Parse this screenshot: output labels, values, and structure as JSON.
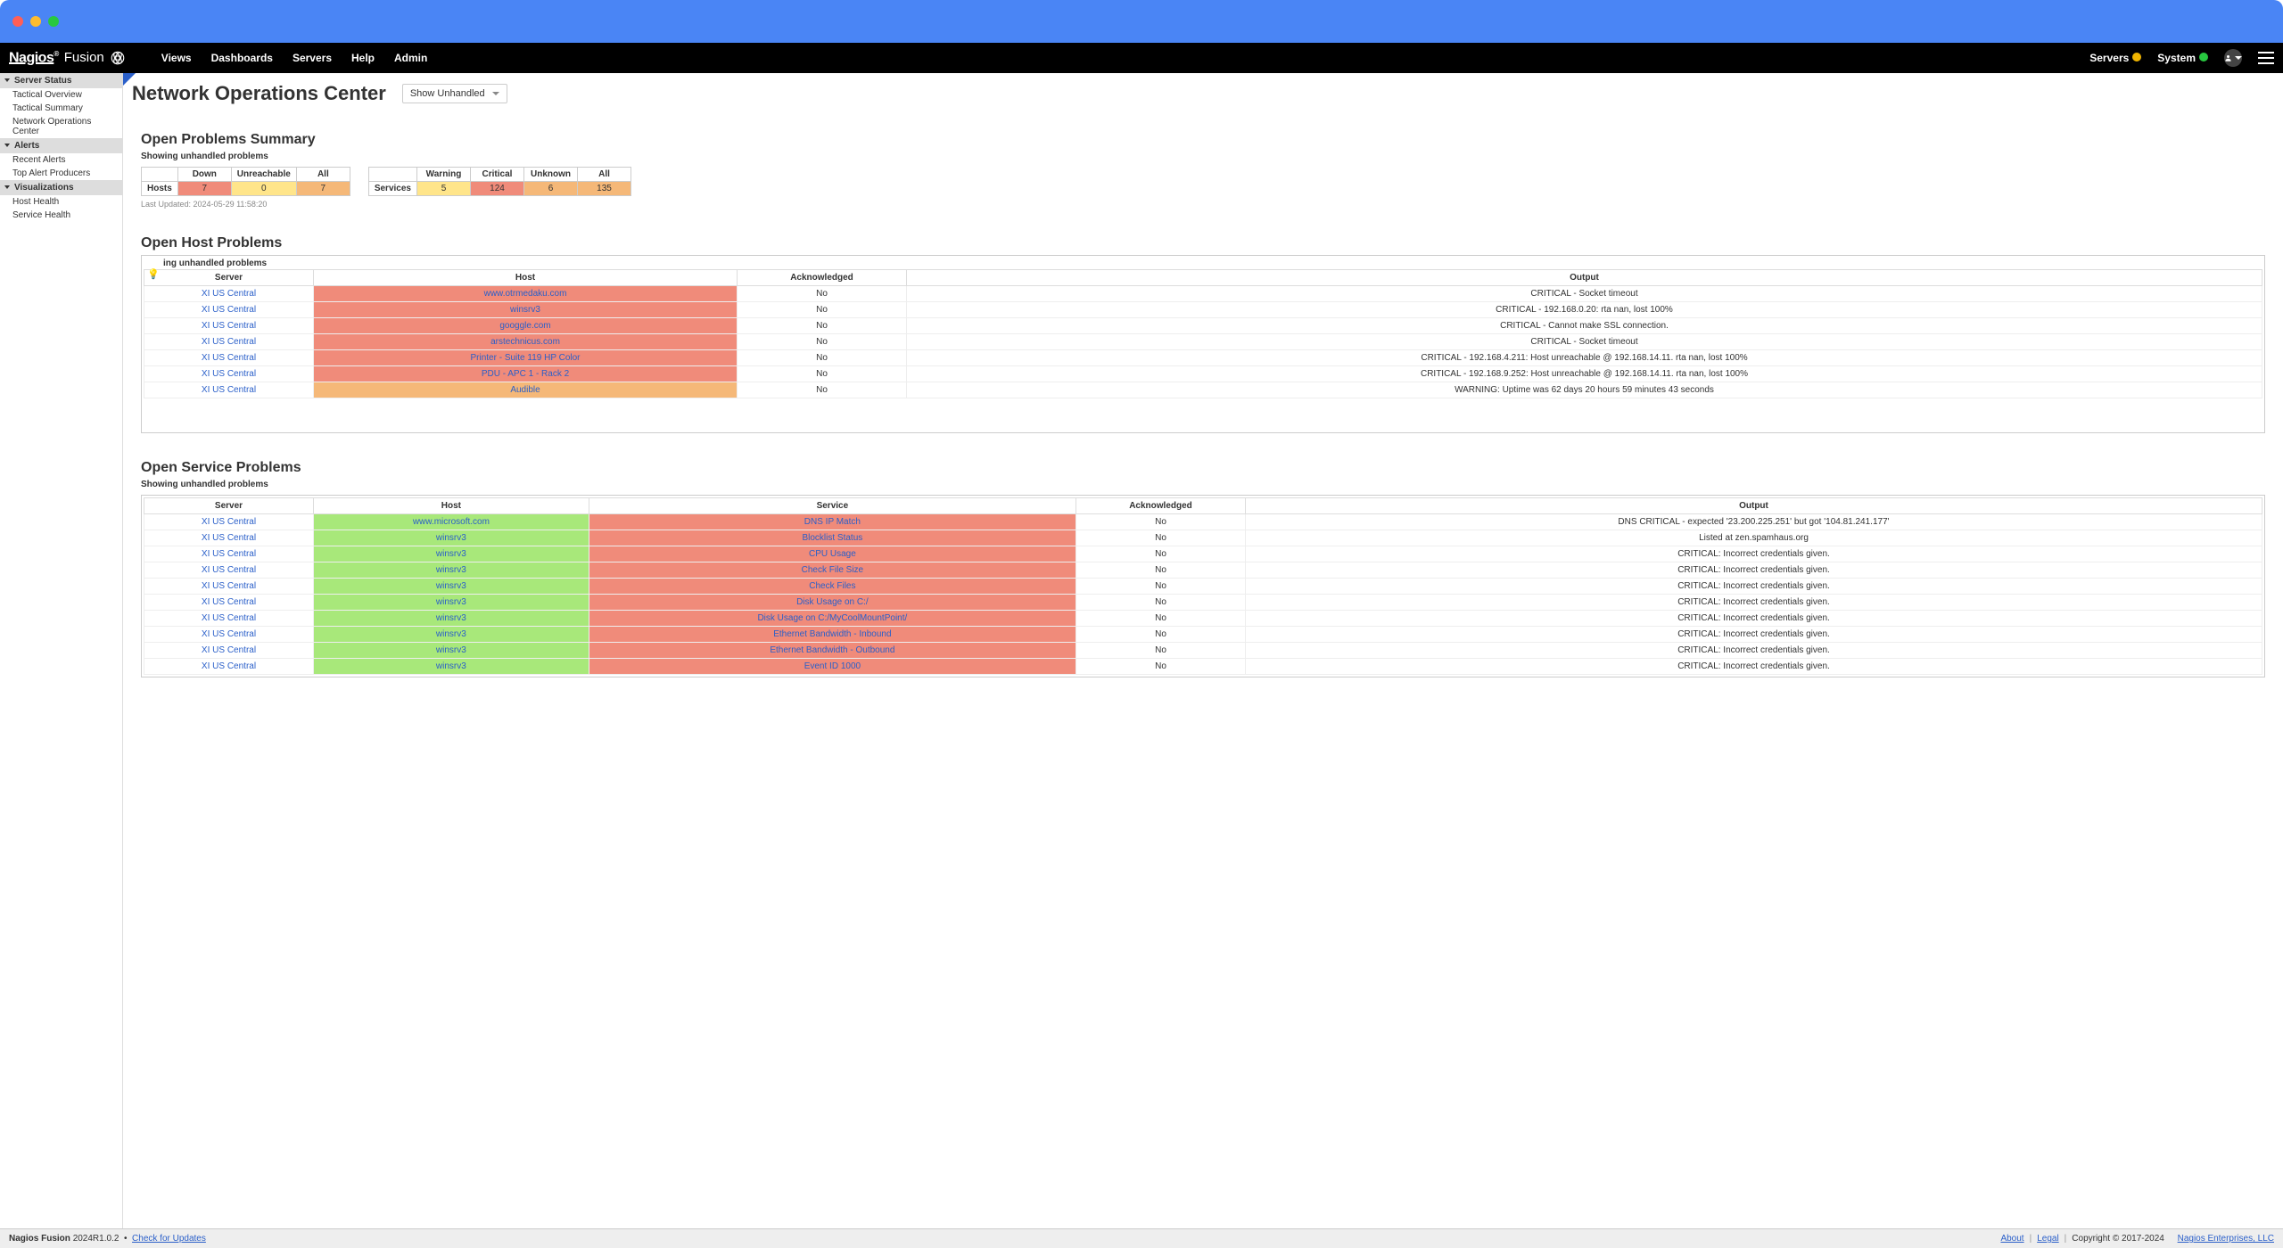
{
  "brand": {
    "main": "Nagios",
    "sub": "Fusion"
  },
  "nav": {
    "views": "Views",
    "dashboards": "Dashboards",
    "servers": "Servers",
    "help": "Help",
    "admin": "Admin",
    "right_servers": "Servers",
    "right_system": "System"
  },
  "sidebar": {
    "groups": [
      {
        "label": "Server Status",
        "items": [
          "Tactical Overview",
          "Tactical Summary",
          "Network Operations Center"
        ]
      },
      {
        "label": "Alerts",
        "items": [
          "Recent Alerts",
          "Top Alert Producers"
        ]
      },
      {
        "label": "Visualizations",
        "items": [
          "Host Health",
          "Service Health"
        ]
      }
    ]
  },
  "page": {
    "title": "Network Operations Center",
    "filter_selected": "Show Unhandled"
  },
  "summary": {
    "title": "Open Problems Summary",
    "subtitle": "Showing unhandled problems",
    "hosts": {
      "row_label": "Hosts",
      "headers": [
        "Down",
        "Unreachable",
        "All"
      ],
      "values": [
        "7",
        "0",
        "7"
      ],
      "classes": [
        "cell-red",
        "cell-yellow",
        "cell-orange"
      ]
    },
    "services": {
      "row_label": "Services",
      "headers": [
        "Warning",
        "Critical",
        "Unknown",
        "All"
      ],
      "values": [
        "5",
        "124",
        "6",
        "135"
      ],
      "classes": [
        "cell-yellow",
        "cell-red",
        "cell-orange",
        "cell-orange"
      ]
    },
    "last_updated": "Last Updated: 2024-05-29 11:58:20"
  },
  "host_problems": {
    "title": "Open Host Problems",
    "caption": "ing unhandled problems",
    "headers": [
      "Server",
      "Host",
      "Acknowledged",
      "Output"
    ],
    "rows": [
      {
        "server": "XI US Central",
        "host": "www.otrmedaku.com",
        "host_class": "host-critical",
        "ack": "No",
        "output": "CRITICAL - Socket timeout"
      },
      {
        "server": "XI US Central",
        "host": "winsrv3",
        "host_class": "host-critical",
        "ack": "No",
        "output": "CRITICAL - 192.168.0.20: rta nan, lost 100%"
      },
      {
        "server": "XI US Central",
        "host": "googgle.com",
        "host_class": "host-critical",
        "ack": "No",
        "output": "CRITICAL - Cannot make SSL connection."
      },
      {
        "server": "XI US Central",
        "host": "arstechnicus.com",
        "host_class": "host-critical",
        "ack": "No",
        "output": "CRITICAL - Socket timeout"
      },
      {
        "server": "XI US Central",
        "host": "Printer - Suite 119 HP Color",
        "host_class": "host-critical",
        "ack": "No",
        "output": "CRITICAL - 192.168.4.211: Host unreachable @ 192.168.14.11. rta nan, lost 100%"
      },
      {
        "server": "XI US Central",
        "host": "PDU - APC 1 - Rack 2",
        "host_class": "host-critical",
        "ack": "No",
        "output": "CRITICAL - 192.168.9.252: Host unreachable @ 192.168.14.11. rta nan, lost 100%"
      },
      {
        "server": "XI US Central",
        "host": "Audible",
        "host_class": "host-warning",
        "ack": "No",
        "output": "WARNING: Uptime was 62 days 20 hours 59 minutes 43 seconds"
      }
    ]
  },
  "service_problems": {
    "title": "Open Service Problems",
    "subtitle": "Showing unhandled problems",
    "headers": [
      "Server",
      "Host",
      "Service",
      "Acknowledged",
      "Output"
    ],
    "rows": [
      {
        "server": "XI US Central",
        "host": "www.microsoft.com",
        "service": "DNS IP Match",
        "ack": "No",
        "output": "DNS CRITICAL - expected '23.200.225.251' but got '104.81.241.177'"
      },
      {
        "server": "XI US Central",
        "host": "winsrv3",
        "service": "Blocklist Status",
        "ack": "No",
        "output": "Listed at zen.spamhaus.org"
      },
      {
        "server": "XI US Central",
        "host": "winsrv3",
        "service": "CPU Usage",
        "ack": "No",
        "output": "CRITICAL: Incorrect credentials given."
      },
      {
        "server": "XI US Central",
        "host": "winsrv3",
        "service": "Check File Size",
        "ack": "No",
        "output": "CRITICAL: Incorrect credentials given."
      },
      {
        "server": "XI US Central",
        "host": "winsrv3",
        "service": "Check Files",
        "ack": "No",
        "output": "CRITICAL: Incorrect credentials given."
      },
      {
        "server": "XI US Central",
        "host": "winsrv3",
        "service": "Disk Usage on C:/",
        "ack": "No",
        "output": "CRITICAL: Incorrect credentials given."
      },
      {
        "server": "XI US Central",
        "host": "winsrv3",
        "service": "Disk Usage on C:/MyCoolMountPoint/",
        "ack": "No",
        "output": "CRITICAL: Incorrect credentials given."
      },
      {
        "server": "XI US Central",
        "host": "winsrv3",
        "service": "Ethernet Bandwidth - Inbound",
        "ack": "No",
        "output": "CRITICAL: Incorrect credentials given."
      },
      {
        "server": "XI US Central",
        "host": "winsrv3",
        "service": "Ethernet Bandwidth - Outbound",
        "ack": "No",
        "output": "CRITICAL: Incorrect credentials given."
      },
      {
        "server": "XI US Central",
        "host": "winsrv3",
        "service": "Event ID 1000",
        "ack": "No",
        "output": "CRITICAL: Incorrect credentials given."
      }
    ]
  },
  "footer": {
    "product": "Nagios Fusion",
    "version": "2024R1.0.2",
    "bullet": "•",
    "check_updates": "Check for Updates",
    "about": "About",
    "legal": "Legal",
    "copyright": "Copyright © 2017-2024",
    "company": "Nagios Enterprises, LLC"
  }
}
